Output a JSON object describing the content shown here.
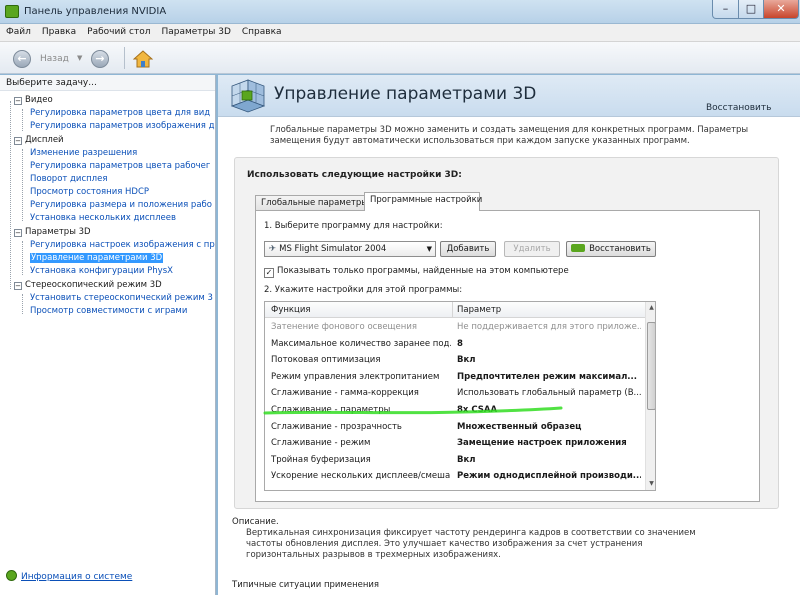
{
  "window": {
    "title": "Панель управления NVIDIA",
    "min_glyph": "–",
    "max_glyph": "□",
    "close_glyph": "✕"
  },
  "menu": [
    "Файл",
    "Правка",
    "Рабочий стол",
    "Параметры 3D",
    "Справка"
  ],
  "toolbar": {
    "back_label": "Назад",
    "back_glyph": "←",
    "forward_glyph": "→",
    "dropdown_glyph": "▼"
  },
  "sidebar": {
    "header": "Выберите задачу...",
    "categories": [
      {
        "label": "Видео",
        "items": [
          "Регулировка параметров цвета для вид",
          "Регулировка параметров изображения д"
        ]
      },
      {
        "label": "Дисплей",
        "items": [
          "Изменение разрешения",
          "Регулировка параметров цвета рабочег",
          "Поворот дисплея",
          "Просмотр состояния HDCP",
          "Регулировка размера и положения рабо",
          "Установка нескольких дисплеев"
        ]
      },
      {
        "label": "Параметры 3D",
        "items": [
          "Регулировка настроек изображения с пр",
          "Управление параметрами 3D",
          "Установка конфигурации PhysX"
        ]
      },
      {
        "label": "Стереоскопический режим 3D",
        "items": [
          "Установить стереоскопический режим 3",
          "Просмотр совместимости с играми"
        ]
      }
    ],
    "collapse_glyph": "−",
    "selected_item": "Управление параметрами 3D",
    "system_info": "Информация о системе"
  },
  "main": {
    "page_title": "Управление параметрами 3D",
    "restore_link": "Восстановить",
    "intro": "Глобальные параметры 3D можно заменить и создать замещения для конкретных программ. Параметры замещения будут автоматически использоваться при каждом запуске указанных программ.",
    "group_label": "Использовать следующие настройки 3D:",
    "tabs": [
      "Глобальные параметры",
      "Программные настройки"
    ],
    "active_tab": "Программные настройки",
    "step1": "1. Выберите программу для настройки:",
    "program_selected": "MS Flight Simulator 2004",
    "plane_glyph": "✈",
    "add_button": "Добавить",
    "remove_button": "Удалить",
    "restore_button": "Восстановить",
    "checkbox_checked": true,
    "checkbox_glyph": "✓",
    "checkbox_label": "Показывать только программы, найденные на этом компьютере",
    "step2": "2. Укажите настройки для этой программы:",
    "grid": {
      "col_function": "Функция",
      "col_param": "Параметр",
      "rows": [
        {
          "function": "Затенение фонового освещения",
          "param": "Не поддерживается для этого приложе...",
          "bold": false,
          "greyed": true
        },
        {
          "function": "Максимальное количество заранее под...",
          "param": "8",
          "bold": true,
          "greyed": false
        },
        {
          "function": "Потоковая оптимизация",
          "param": "Вкл",
          "bold": true,
          "greyed": false
        },
        {
          "function": "Режим управления электропитанием",
          "param": "Предпочтителен режим максимал...",
          "bold": true,
          "greyed": false
        },
        {
          "function": "Сглаживание - гамма-коррекция",
          "param": "Использовать глобальный параметр (В...",
          "bold": false,
          "greyed": false
        },
        {
          "function": "Сглаживание - параметры",
          "param": "8x CSAA",
          "bold": true,
          "greyed": false
        },
        {
          "function": "Сглаживание - прозрачность",
          "param": "Множественный образец",
          "bold": true,
          "greyed": false
        },
        {
          "function": "Сглаживание - режим",
          "param": "Замещение настроек приложения",
          "bold": true,
          "greyed": false
        },
        {
          "function": "Тройная буферизация",
          "param": "Вкл",
          "bold": true,
          "greyed": false
        },
        {
          "function": "Ускорение нескольких дисплеев/смеша...",
          "param": "Режим однодисплейной производи...",
          "bold": true,
          "greyed": false
        }
      ],
      "scroll_up_glyph": "▲",
      "scroll_down_glyph": "▼"
    },
    "description_label": "Описание.",
    "description": "Вертикальная синхронизация фиксирует частоту рендеринга кадров в соответствии со значением частоты обновления дисплея. Это улучшает качество изображения за счет устранения горизонтальных разрывов в трехмерных изображениях.",
    "typical_label": "Типичные ситуации применения"
  },
  "colors": {
    "nvidia_green": "#5aa61e",
    "link_blue": "#0b50b8",
    "selection_blue": "#3399ff",
    "highlight_stroke": "#33dd22"
  }
}
